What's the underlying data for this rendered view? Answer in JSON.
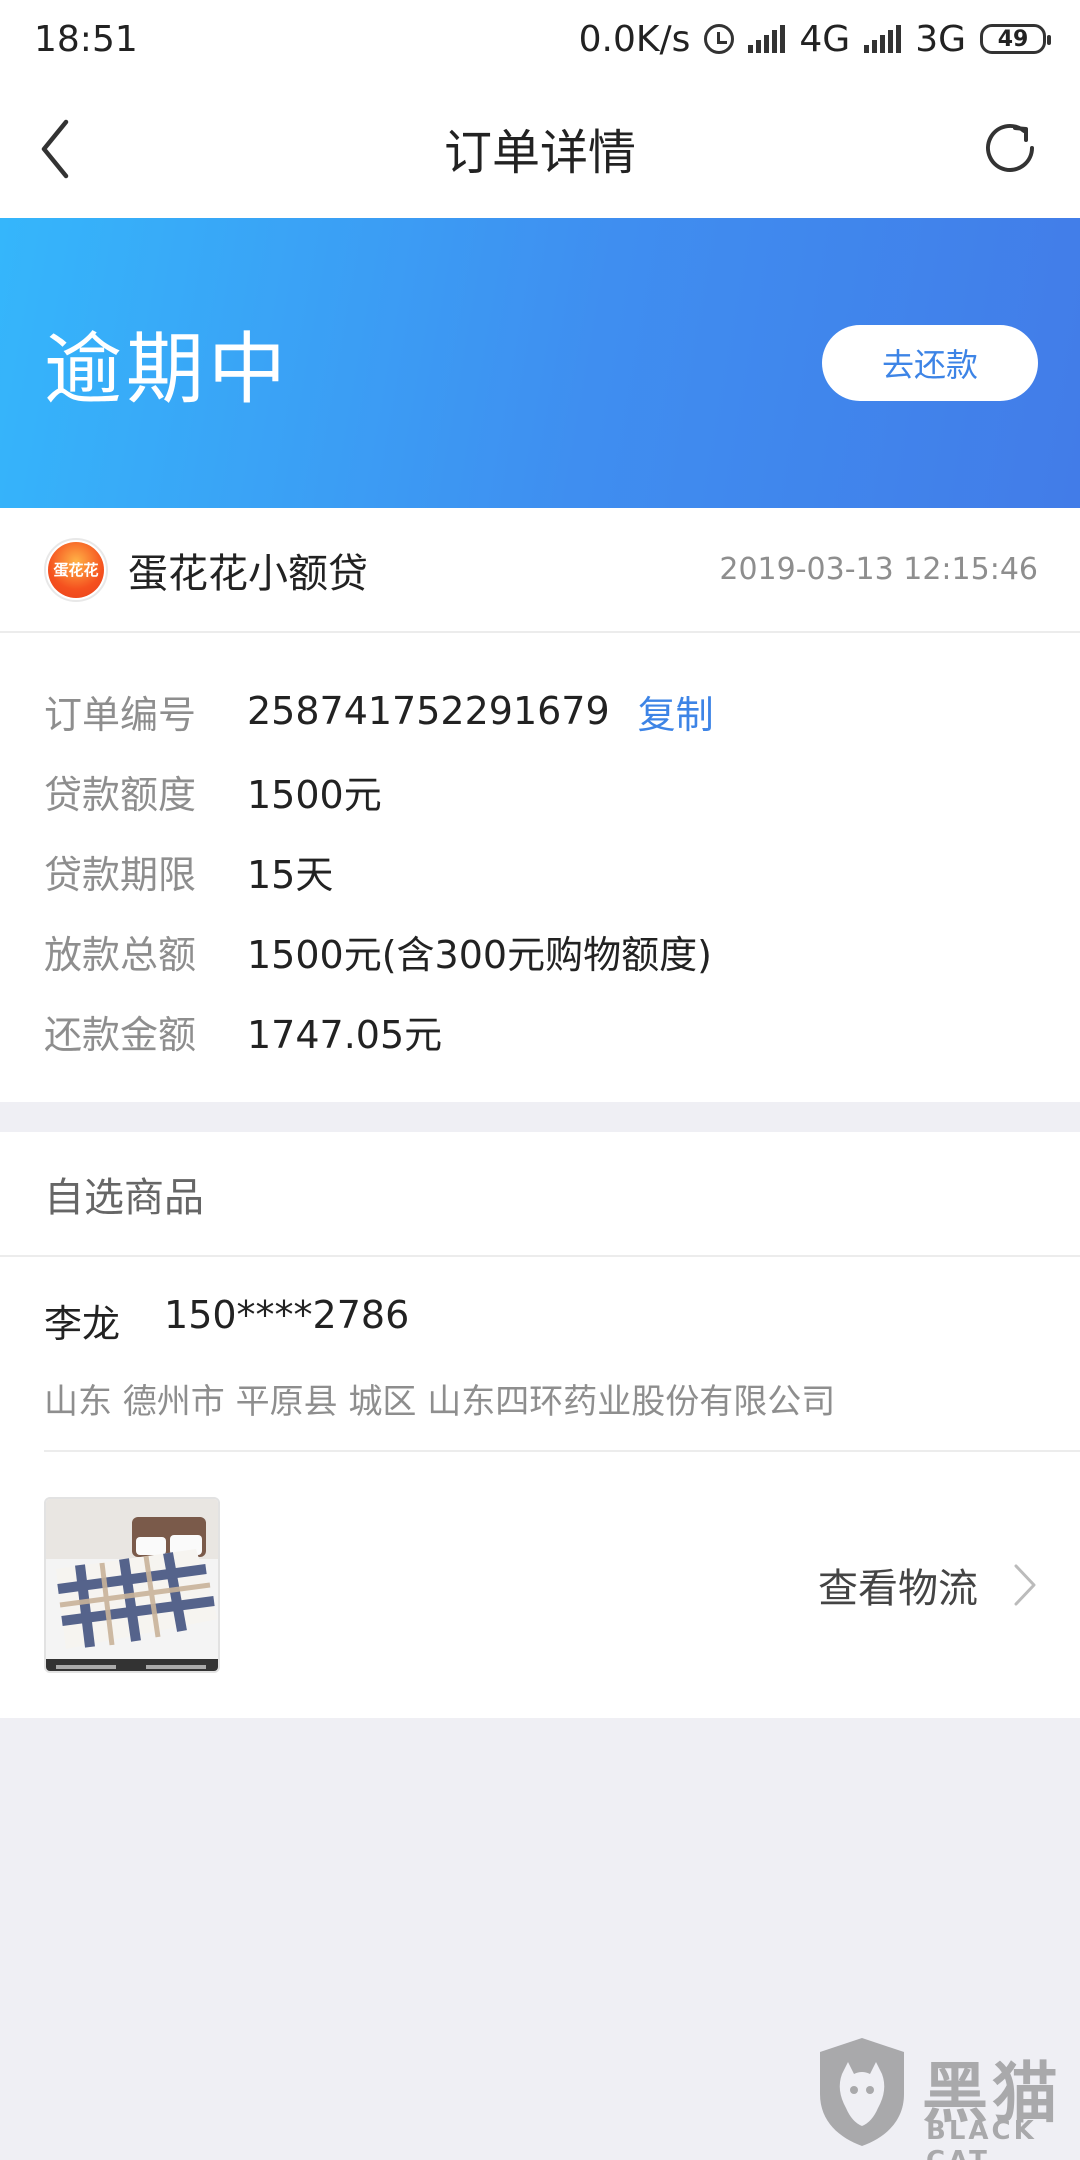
{
  "status_bar": {
    "time": "18:51",
    "net_speed": "0.0K/s",
    "network1": "4G",
    "network2": "3G",
    "battery": "49"
  },
  "nav": {
    "title": "订单详情"
  },
  "banner": {
    "status": "逾期中",
    "repay_button": "去还款"
  },
  "lender": {
    "logo_text": "蛋花花",
    "name": "蛋花花小额贷",
    "time": "2019-03-13 12:15:46"
  },
  "details": {
    "order_no_label": "订单编号",
    "order_no_value": "258741752291679",
    "copy_label": "复制",
    "amount_label": "贷款额度",
    "amount_value": "1500元",
    "term_label": "贷款期限",
    "term_value": "15天",
    "disbursed_label": "放款总额",
    "disbursed_value": "1500元(含300元购物额度)",
    "repay_label": "还款金额",
    "repay_value": "1747.05元"
  },
  "goods": {
    "header": "自选商品",
    "contact_name": "李龙",
    "contact_phone": "150****2786",
    "address": "山东 德州市 平原县 城区 山东四环药业股份有限公司",
    "logistics_label": "查看物流"
  },
  "watermark": {
    "cn": "黑猫",
    "en": "BLACK CAT"
  },
  "colors": {
    "accent": "#3d84e6",
    "banner_start": "#35b6fb",
    "banner_end": "#427ce8"
  }
}
